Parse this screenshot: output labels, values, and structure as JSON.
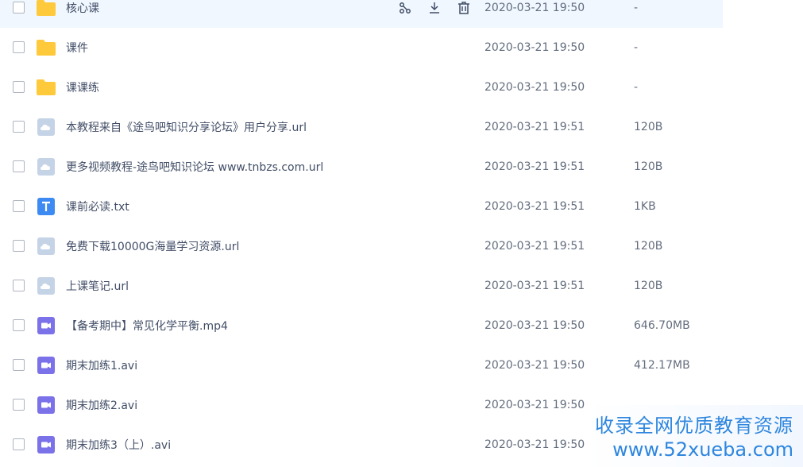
{
  "files": [
    {
      "name": "核心课",
      "date": "2020-03-21 19:50",
      "size": "-",
      "type": "folder"
    },
    {
      "name": "课件",
      "date": "2020-03-21 19:50",
      "size": "-",
      "type": "folder"
    },
    {
      "name": "课课练",
      "date": "2020-03-21 19:50",
      "size": "-",
      "type": "folder"
    },
    {
      "name": "本教程来自《途鸟吧知识分享论坛》用户分享.url",
      "date": "2020-03-21 19:51",
      "size": "120B",
      "type": "link"
    },
    {
      "name": "更多视频教程-途鸟吧知识论坛 www.tnbzs.com.url",
      "date": "2020-03-21 19:51",
      "size": "120B",
      "type": "link"
    },
    {
      "name": "课前必读.txt",
      "date": "2020-03-21 19:51",
      "size": "1KB",
      "type": "text"
    },
    {
      "name": "免费下载10000G海量学习资源.url",
      "date": "2020-03-21 19:51",
      "size": "120B",
      "type": "link"
    },
    {
      "name": "上课笔记.url",
      "date": "2020-03-21 19:51",
      "size": "120B",
      "type": "link"
    },
    {
      "name": "【备考期中】常见化学平衡.mp4",
      "date": "2020-03-21 19:50",
      "size": "646.70MB",
      "type": "video"
    },
    {
      "name": "期末加练1.avi",
      "date": "2020-03-21 19:50",
      "size": "412.17MB",
      "type": "video"
    },
    {
      "name": "期末加练2.avi",
      "date": "2020-03-21 19:50",
      "size": "",
      "type": "video"
    },
    {
      "name": "期末加练3（上）.avi",
      "date": "2020-03-21 19:50",
      "size": "",
      "type": "video"
    }
  ],
  "icons": {
    "folder": "folder-icon",
    "link": "link-file-icon",
    "text": "text-file-icon",
    "video": "video-file-icon",
    "actions": [
      "share-icon",
      "download-icon",
      "delete-icon"
    ]
  },
  "colors": {
    "folder": "#ffc93c",
    "link": "#c5d3e6",
    "text": "#3d8bf2",
    "video": "#7b71e8",
    "hover_row": "#f0f7ff",
    "watermark": "#2e86de"
  },
  "watermark": {
    "line1": "收录全网优质教育资源",
    "line2": "www.52xueba.com"
  }
}
